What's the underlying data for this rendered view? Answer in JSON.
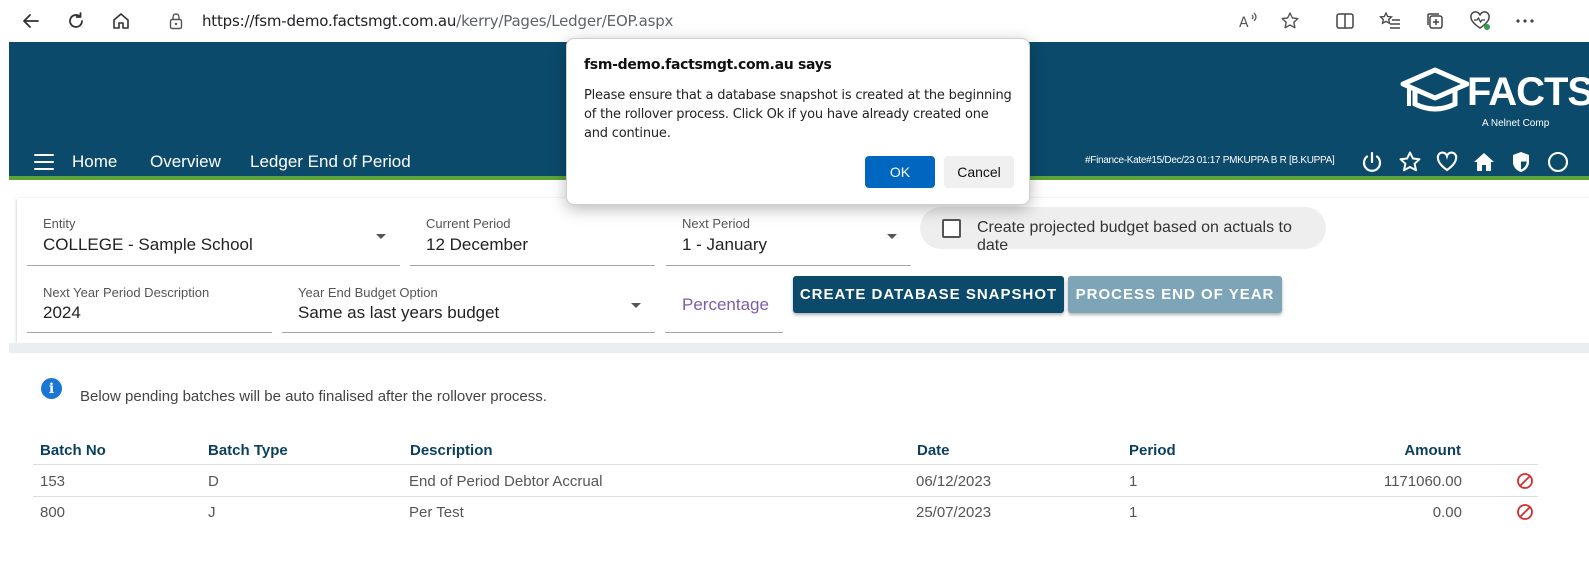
{
  "browser": {
    "url_host": "https://fsm-demo.factsmgt.com.au",
    "url_path": "/kerry/Pages/Ledger/EOP.aspx"
  },
  "header": {
    "nav": [
      "Home",
      "Overview",
      "Ledger End of Period"
    ],
    "logo_text": "FACTS",
    "logo_tagline": "A Nelnet Comp",
    "user_info": "#Finance-Kate#15/Dec/23 01:17 PMKUPPA B R [B.KUPPA]",
    "brand_color": "#0b4a6b",
    "accent_line_color": "#5aa43a"
  },
  "form": {
    "entity": {
      "label": "Entity",
      "value": "COLLEGE - Sample School"
    },
    "current_period": {
      "label": "Current Period",
      "value": "12 December"
    },
    "next_period": {
      "label": "Next Period",
      "value": "1 - January"
    },
    "projected_budget_checkbox": {
      "label": "Create projected budget based on actuals to date",
      "checked": false
    },
    "next_year_desc": {
      "label": "Next Year Period Description",
      "value": "2024"
    },
    "year_end_budget": {
      "label": "Year End Budget Option",
      "value": "Same as last years budget"
    },
    "percentage_placeholder": "Percentage",
    "create_snapshot_label": "CREATE DATABASE SNAPSHOT",
    "process_eoy_label": "PROCESS END OF YEAR"
  },
  "batches": {
    "info": "Below pending batches will be auto finalised after the rollover process.",
    "columns": [
      "Batch No",
      "Batch Type",
      "Description",
      "Date",
      "Period",
      "Amount"
    ],
    "rows": [
      {
        "batch_no": "153",
        "type": "D",
        "description": "End of Period Debtor Accrual",
        "date": "06/12/2023",
        "period": "1",
        "amount": "1171060.00"
      },
      {
        "batch_no": "800",
        "type": "J",
        "description": "Per Test",
        "date": "25/07/2023",
        "period": "1",
        "amount": "0.00"
      }
    ]
  },
  "dialog": {
    "title": "fsm-demo.factsmgt.com.au says",
    "message": "Please ensure that a database snapshot is created at the beginning of the rollover process. Click Ok if you have already created one and continue.",
    "ok_label": "OK",
    "cancel_label": "Cancel"
  }
}
